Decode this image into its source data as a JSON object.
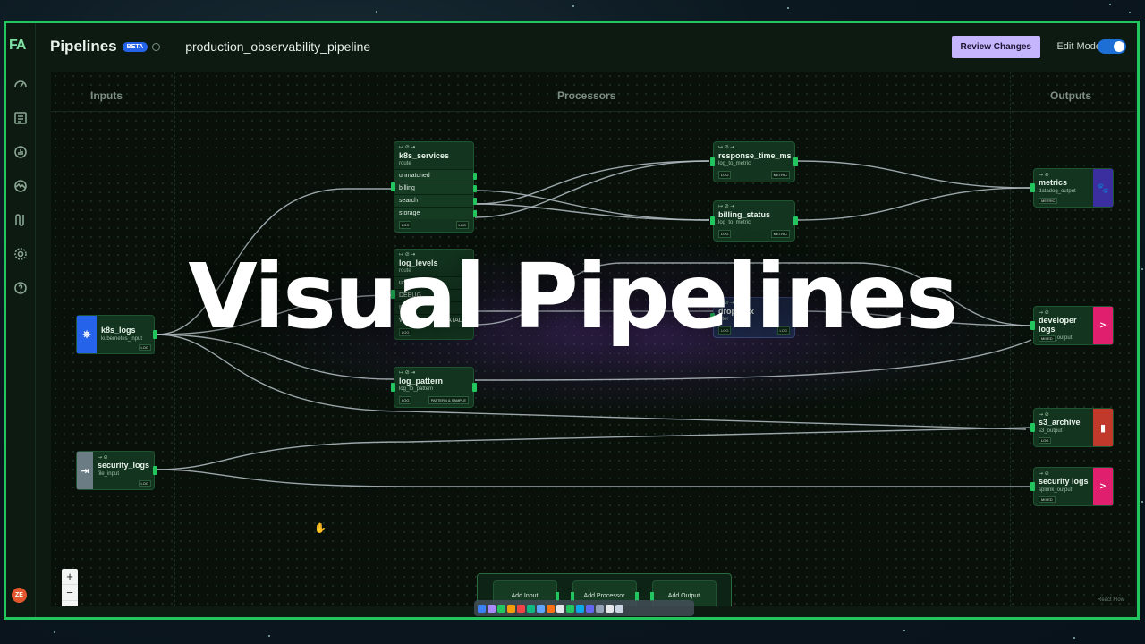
{
  "logo": "FA",
  "header": {
    "title": "Pipelines",
    "beta_badge": "BETA",
    "pipeline_name": "production_observability_pipeline",
    "review_button": "Review Changes",
    "edit_mode_label": "Edit Mode",
    "edit_mode_on": true
  },
  "rail": {
    "icons": [
      "dashboard-icon",
      "list-icon",
      "chart-icon",
      "activity-icon",
      "pipeline-icon",
      "settings-icon",
      "help-icon"
    ],
    "avatar_initials": "ZE"
  },
  "canvas": {
    "columns": [
      "Inputs",
      "Processors",
      "Outputs"
    ],
    "inputs": [
      {
        "name": "k8s_logs",
        "type": "kubernetes_input",
        "tag": "LOG",
        "icon": "kubernetes-icon",
        "color": "#2563eb"
      },
      {
        "name": "security_logs",
        "type": "file_input",
        "tag": "LOG",
        "icon": "file-input-icon",
        "color": "#6b7c85"
      }
    ],
    "processors": {
      "k8s_services": {
        "name": "k8s_services",
        "kind": "route",
        "routes": [
          "unmatched",
          "billing",
          "search",
          "storage"
        ],
        "badge_left": "LOG",
        "badge_right": "LOG"
      },
      "log_levels": {
        "name": "log_levels",
        "kind": "route",
        "routes": [
          "unmatched",
          "DEBUG",
          "INFO",
          "WARN/ERROR/FATAL"
        ],
        "badge_left": "LOG"
      },
      "log_pattern": {
        "name": "log_pattern",
        "kind": "log_to_pattern",
        "badge_left": "LOG",
        "badge_right": "PATTERN & SAMPLE"
      },
      "response_time_ms": {
        "name": "response_time_ms",
        "kind": "log_to_metric",
        "badge_left": "LOG",
        "badge_right": "METRIC"
      },
      "billing_status": {
        "name": "billing_status",
        "kind": "log_to_metric",
        "badge_left": "LOG",
        "badge_right": "METRIC"
      },
      "drop_2xx": {
        "name": "drop_2xx",
        "kind": "filter",
        "badge_left": "LOG",
        "badge_right": "LOG"
      }
    },
    "outputs": [
      {
        "name": "metrics",
        "type": "datadog_output",
        "tag": "METRIC",
        "icon": "datadog-icon",
        "color": "#3b2fa0"
      },
      {
        "name": "developer logs",
        "type": "splunk_output",
        "tag": "MIXED",
        "icon": "splunk-icon",
        "color": "#e0206e"
      },
      {
        "name": "s3_archive",
        "type": "s3_output",
        "tag": "LOG",
        "icon": "s3-icon",
        "color": "#c0392b"
      },
      {
        "name": "security logs",
        "type": "splunk_output",
        "tag": "MIXED",
        "icon": "splunk-icon",
        "color": "#e0206e"
      }
    ],
    "add_buttons": [
      "Add Input",
      "Add Processor",
      "Add Output"
    ],
    "zoom_controls": [
      "+",
      "−",
      "⛶"
    ],
    "attribution": "React Flow"
  },
  "overlay_title": "Visual Pipelines"
}
